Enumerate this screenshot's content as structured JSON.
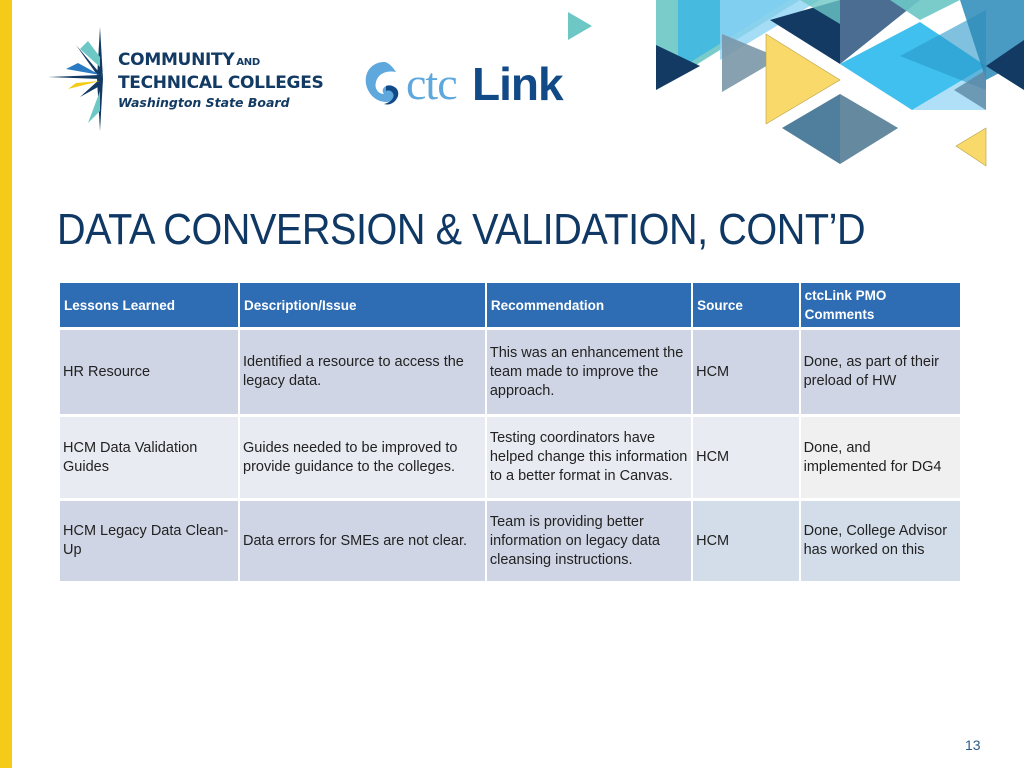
{
  "slide": {
    "title": "DATA CONVERSION & VALIDATION, CONT’D",
    "page_number": "13",
    "accent_color": "#f4cc17",
    "title_color": "#0f3864",
    "header_color": "#2e6db4"
  },
  "logos": {
    "sbctc": {
      "line1": "COMMUNITY",
      "line1_small": "AND",
      "line2": "TECHNICAL COLLEGES",
      "line3": "Washington State Board",
      "icon": "starburst-logo-icon"
    },
    "ctclink": {
      "ctc": "ctc",
      "link": "Link",
      "icon": "swirl-logo-icon"
    }
  },
  "table": {
    "headers": [
      "Lessons Learned",
      "Description/Issue",
      "Recommendation",
      "Source",
      "ctcLink PMO Comments"
    ],
    "rows": [
      [
        "HR Resource",
        "Identified a resource to access the legacy data.",
        "This was an enhancement the team made to improve the approach.",
        "HCM",
        "Done, as part of their preload of HW"
      ],
      [
        "HCM Data Validation Guides",
        "Guides needed to be improved to provide guidance to the colleges.",
        "Testing coordinators have helped change this information to a better format in Canvas.",
        "HCM",
        "Done, and implemented for DG4"
      ],
      [
        "HCM Legacy Data Clean-Up",
        "Data errors for SMEs are not clear.",
        "Team is providing better information on legacy data cleansing instructions.",
        "HCM",
        "Done, College Advisor has worked on this"
      ]
    ]
  }
}
